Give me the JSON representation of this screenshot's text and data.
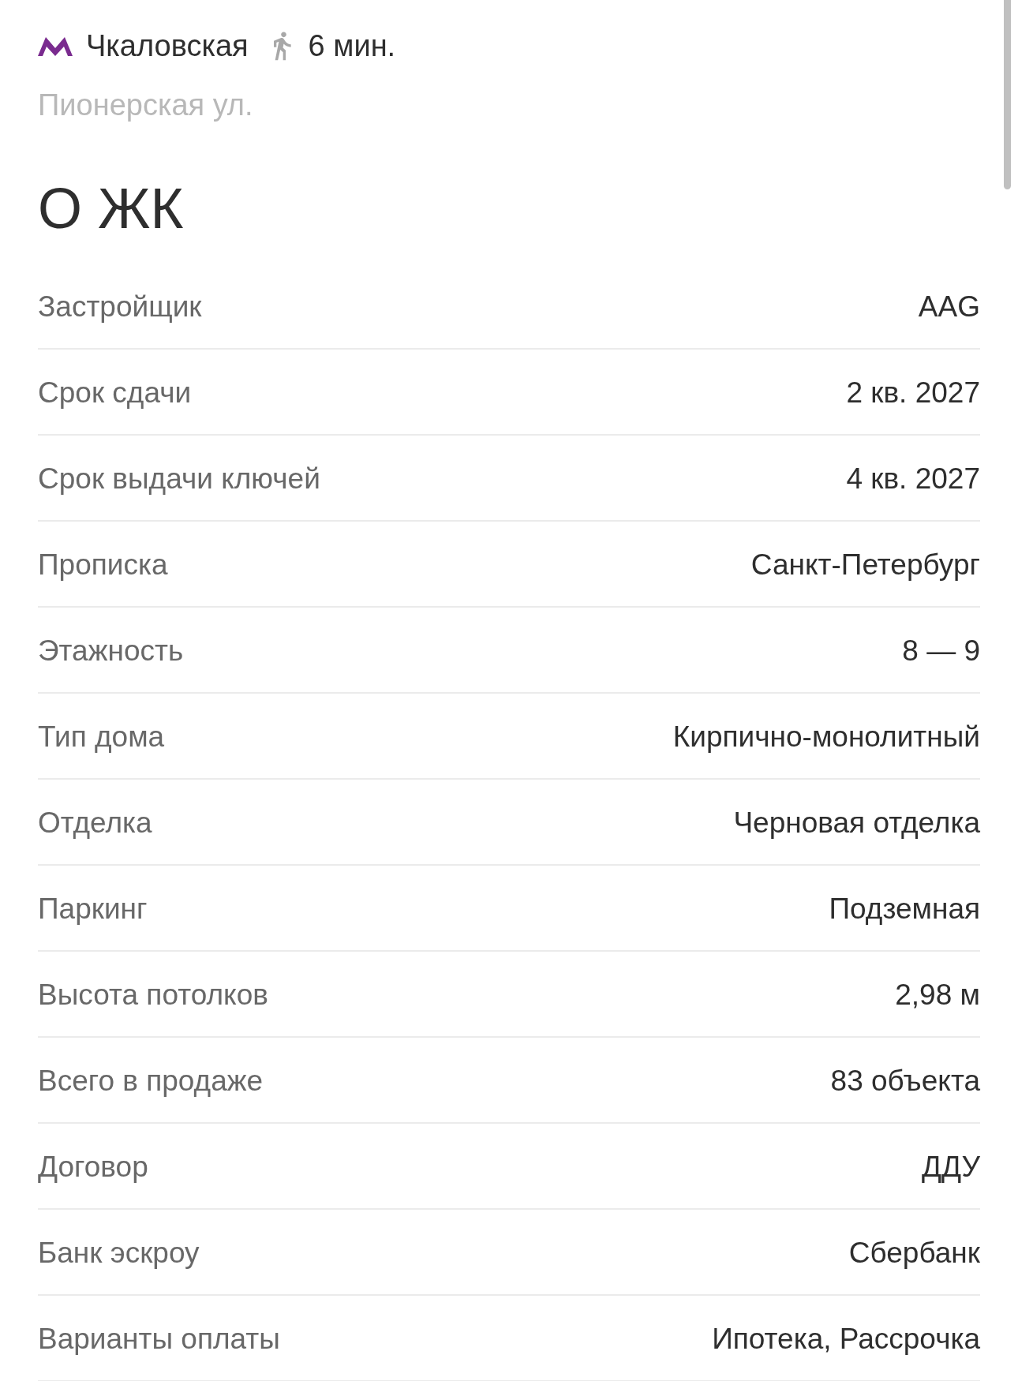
{
  "metro": {
    "station": "Чкаловская",
    "walk_time": "6 мин."
  },
  "address": "Пионерская ул.",
  "section_title": "О ЖК",
  "details": [
    {
      "label": "Застройщик",
      "value": "AAG"
    },
    {
      "label": "Срок сдачи",
      "value": "2 кв. 2027"
    },
    {
      "label": "Срок выдачи ключей",
      "value": "4 кв. 2027"
    },
    {
      "label": "Прописка",
      "value": "Санкт-Петербург"
    },
    {
      "label": "Этажность",
      "value": "8 — 9"
    },
    {
      "label": "Тип дома",
      "value": "Кирпично-монолитный"
    },
    {
      "label": "Отделка",
      "value": "Черновая отделка"
    },
    {
      "label": "Паркинг",
      "value": "Подземная"
    },
    {
      "label": "Высота потолков",
      "value": "2,98 м"
    },
    {
      "label": "Всего в продаже",
      "value": "83 объекта"
    },
    {
      "label": "Договор",
      "value": "ДДУ"
    },
    {
      "label": "Банк эскроу",
      "value": "Сбербанк"
    },
    {
      "label": "Варианты оплаты",
      "value": "Ипотека, Рассрочка"
    }
  ]
}
